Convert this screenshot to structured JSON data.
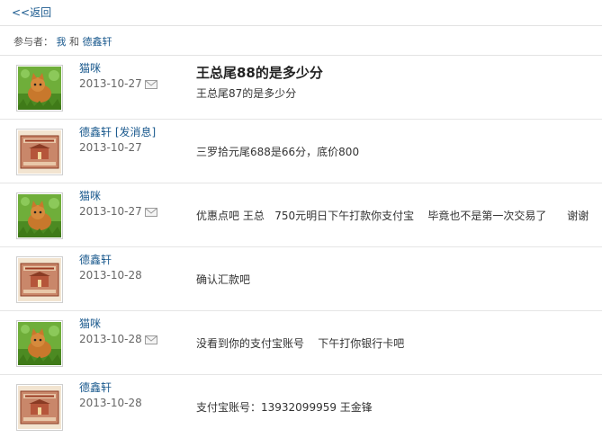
{
  "nav": {
    "back_label": "<<返回"
  },
  "participants": {
    "label": "参与者：",
    "me": "我",
    "and": "和",
    "other": "德鑫轩"
  },
  "messages": [
    {
      "sender": "猫咪",
      "date": "2013-10-27",
      "subject": "王总尾88的是多少分",
      "content": "王总尾87的是多少分",
      "avatar": "cat-avatar",
      "has_mail_icon": true
    },
    {
      "sender": "德鑫轩",
      "send_msg": "[发消息]",
      "date": "2013-10-27",
      "content": "三罗拾元尾688是66分，底价800",
      "avatar": "bank-note-avatar"
    },
    {
      "sender": "猫咪",
      "date": "2013-10-27",
      "content": "优惠点吧 王总   750元明日下午打款你支付宝    毕竟也不是第一次交易了      谢谢",
      "avatar": "cat-avatar",
      "has_mail_icon": true
    },
    {
      "sender": "德鑫轩",
      "date": "2013-10-28",
      "content": "确认汇款吧",
      "avatar": "bank-note-avatar"
    },
    {
      "sender": "猫咪",
      "date": "2013-10-28",
      "content": "没看到你的支付宝账号    下午打你银行卡吧",
      "avatar": "cat-avatar",
      "has_mail_icon": true
    },
    {
      "sender": "德鑫轩",
      "date": "2013-10-28",
      "content": "支付宝账号：13932099959 王金锋",
      "avatar": "bank-note-avatar"
    }
  ],
  "colors": {
    "link": "#1b5a8e",
    "divider": "#e5e5e5",
    "text": "#333333"
  }
}
